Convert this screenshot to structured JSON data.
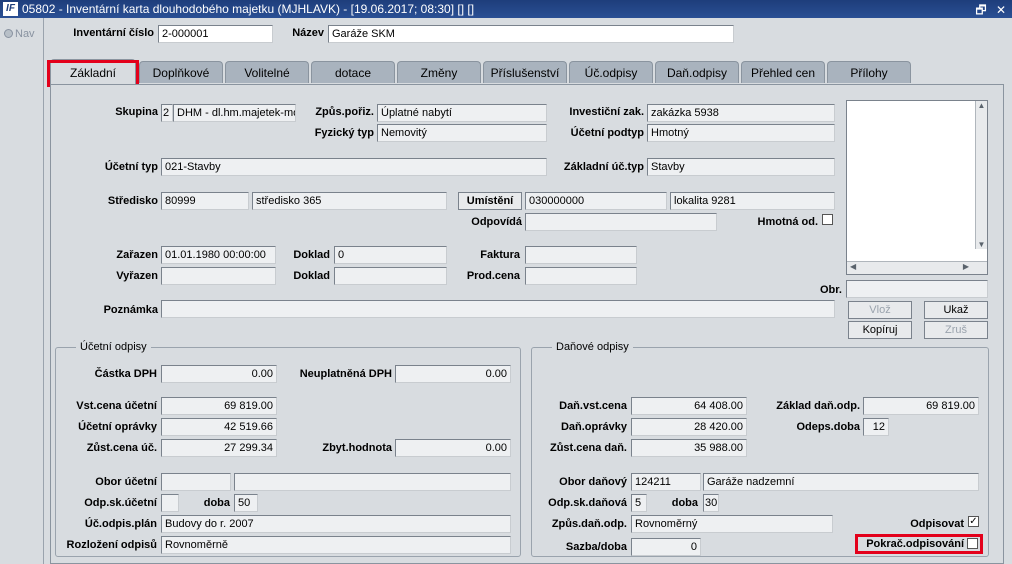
{
  "window": {
    "title": "05802 - Inventární karta dlouhodobého majetku (MJHLAVK) - [19.06.2017; 08:30] [] []",
    "restore_glyph": "🗗",
    "close_glyph": "✕"
  },
  "app_logo": "IF",
  "nav": {
    "label": "Nav"
  },
  "header": {
    "inv_cislo_label": "Inventární číslo",
    "inv_cislo_value": "2-000001",
    "nazev_label": "Název",
    "nazev_value": "Garáže SKM"
  },
  "tabs": [
    "Základní",
    "Doplňkové",
    "Volitelné",
    "dotace",
    "Změny",
    "Příslušenství",
    "Úč.odpisy",
    "Daň.odpisy",
    "Přehled cen",
    "Přílohy"
  ],
  "form": {
    "skupina_label": "Skupina",
    "skupina_code": "2",
    "skupina_name": "DHM - dl.hm.majetek-mov",
    "zpus_poriz_label": "Způs.pořiz.",
    "zpus_poriz_value": "Úplatné nabytí",
    "investicni_zak_label": "Investiční zak.",
    "investicni_zak_value": "zakázka 5938",
    "fyzicky_typ_label": "Fyzický typ",
    "fyzicky_typ_value": "Nemovitý",
    "ucetni_podtyp_label": "Účetní podtyp",
    "ucetni_podtyp_value": "Hmotný",
    "ucetni_typ_label": "Účetní typ",
    "ucetni_typ_value": "021-Stavby",
    "zakladni_uc_typ_label": "Základní úč.typ",
    "zakladni_uc_typ_value": "Stavby",
    "stredisko_label": "Středisko",
    "stredisko_code": "80999",
    "stredisko_name": "středisko 365",
    "umisteni_button": "Umístění",
    "umisteni_code": "030000000",
    "umisteni_name": "lokalita 9281",
    "odpovida_label": "Odpovídá",
    "odpovida_value": "",
    "hmotna_od_label": "Hmotná od.",
    "zarazen_label": "Zařazen",
    "zarazen_value": "01.01.1980 00:00:00",
    "doklad1_label": "Doklad",
    "doklad1_value": "0",
    "faktura_label": "Faktura",
    "faktura_value": "",
    "vyrazen_label": "Vyřazen",
    "vyrazen_value": "",
    "doklad2_label": "Doklad",
    "doklad2_value": "",
    "prod_cena_label": "Prod.cena",
    "prod_cena_value": "",
    "obr_label": "Obr.",
    "obr_value": "",
    "poznamka_label": "Poznámka",
    "poznamka_value": ""
  },
  "image_buttons": {
    "vloz": "Vlož",
    "ukaz": "Ukaž",
    "kopiruj": "Kopíruj",
    "zrus": "Zruš"
  },
  "ucetni": {
    "title": "Účetní odpisy",
    "castka_dph_label": "Částka DPH",
    "castka_dph_value": "0.00",
    "neuplatnena_dph_label": "Neuplatněná DPH",
    "neuplatnena_dph_value": "0.00",
    "vst_cena_label": "Vst.cena účetní",
    "vst_cena_value": "69 819.00",
    "opravky_label": "Účetní oprávky",
    "opravky_value": "42 519.66",
    "zust_cena_label": "Zůst.cena úč.",
    "zust_cena_value": "27 299.34",
    "zbyt_hodnota_label": "Zbyt.hodnota",
    "zbyt_hodnota_value": "0.00",
    "obor_label": "Obor účetní",
    "obor_code": "",
    "obor_name": "",
    "odp_sk_label": "Odp.sk.účetní",
    "odp_sk_value": "",
    "doba_label": "doba",
    "doba_value": "50",
    "odpis_plan_label": "Úč.odpis.plán",
    "odpis_plan_value": "Budovy do r. 2007",
    "rozlozeni_label": "Rozložení odpisů",
    "rozlozeni_value": "Rovnoměrně"
  },
  "danove": {
    "title": "Daňové odpisy",
    "dan_vst_cena_label": "Daň.vst.cena",
    "dan_vst_cena_value": "64 408.00",
    "zaklad_dan_odp_label": "Základ daň.odp.",
    "zaklad_dan_odp_value": "69 819.00",
    "dan_opravky_label": "Daň.oprávky",
    "dan_opravky_value": "28 420.00",
    "odeps_doba_label": "Odeps.doba",
    "odeps_doba_value": "12",
    "zust_cena_dan_label": "Zůst.cena daň.",
    "zust_cena_dan_value": "35 988.00",
    "obor_danovy_label": "Obor daňový",
    "obor_danovy_code": "124211",
    "obor_danovy_name": "Garáže nadzemní",
    "odp_sk_danova_label": "Odp.sk.daňová",
    "odp_sk_danova_value": "5",
    "doba_label": "doba",
    "doba_value": "30",
    "zpus_dan_odp_label": "Způs.daň.odp.",
    "zpus_dan_odp_value": "Rovnoměrný",
    "odpisovat_label": "Odpisovat",
    "sazba_doba_label": "Sazba/doba",
    "sazba_doba_value": "0",
    "pokrac_label": "Pokrač.odpisování"
  }
}
